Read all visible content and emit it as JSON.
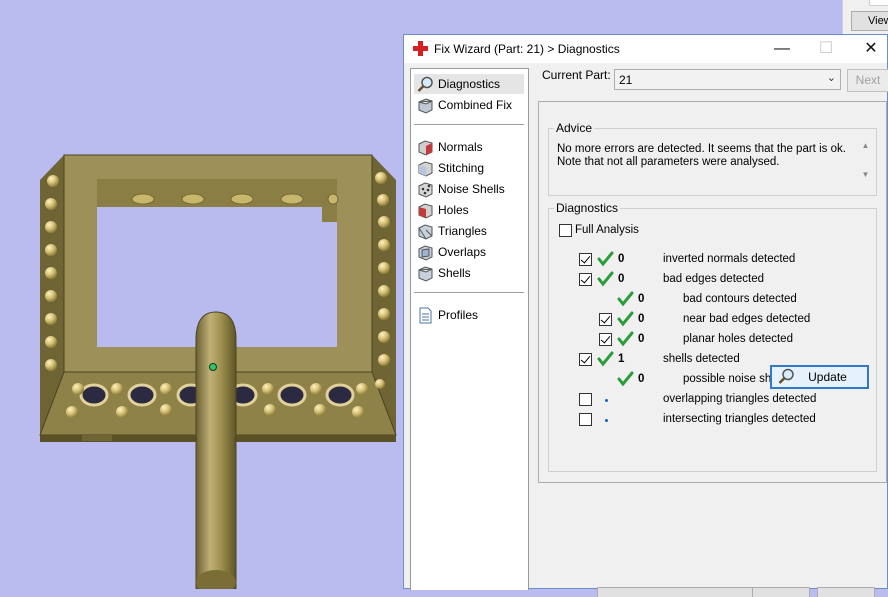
{
  "window": {
    "title": "Fix Wizard (Part: 21) > Diagnostics",
    "minimize_glyph": "—",
    "maximize_glyph": "☐",
    "close_glyph": "✕"
  },
  "background_window": {
    "button_label": "View"
  },
  "nav": {
    "items": [
      {
        "label": "Diagnostics",
        "icon": "magnifier-icon",
        "selected": true
      },
      {
        "label": "Combined Fix",
        "icon": "combined-fix-icon"
      },
      {
        "label": "Normals",
        "icon": "normals-cube-icon"
      },
      {
        "label": "Stitching",
        "icon": "stitching-cube-icon"
      },
      {
        "label": "Noise Shells",
        "icon": "noise-shells-icon"
      },
      {
        "label": "Holes",
        "icon": "holes-cube-icon"
      },
      {
        "label": "Triangles",
        "icon": "triangles-cube-icon"
      },
      {
        "label": "Overlaps",
        "icon": "overlaps-cube-icon"
      },
      {
        "label": "Shells",
        "icon": "shells-cube-icon"
      },
      {
        "label": "Profiles",
        "icon": "document-icon"
      }
    ]
  },
  "current_part": {
    "label": "Current Part:",
    "value": "21"
  },
  "next_button": "Next",
  "advice": {
    "title": "Advice",
    "line1": "No more errors are detected. It seems that the part is ok.",
    "line2": "Note that not all parameters were analysed."
  },
  "diagnostics": {
    "title": "Diagnostics",
    "full_analysis": "Full Analysis",
    "rows": [
      {
        "value": "0",
        "label": "inverted normals detected",
        "checked": true,
        "status": "ok"
      },
      {
        "value": "0",
        "label": "bad edges detected",
        "checked": true,
        "status": "ok"
      },
      {
        "value": "0",
        "label": "bad contours detected",
        "status": "ok"
      },
      {
        "value": "0",
        "label": "near bad edges detected",
        "checked": true,
        "status": "ok"
      },
      {
        "value": "0",
        "label": "planar holes detected",
        "checked": true,
        "status": "ok"
      },
      {
        "value": "1",
        "label": "shells detected",
        "checked": true,
        "status": "ok"
      },
      {
        "value": "0",
        "label": "possible noise shells detected",
        "status": "ok"
      },
      {
        "value": "",
        "label": "overlapping triangles detected",
        "checked": false,
        "status": "pending"
      },
      {
        "value": "",
        "label": "intersecting triangles detected",
        "checked": false,
        "status": "pending"
      }
    ],
    "update_button": "Update"
  },
  "colors": {
    "viewport_bg": "#babcf0",
    "model": "#9c8f55",
    "check_green": "#2a9d3a",
    "accent": "#3178c6"
  }
}
